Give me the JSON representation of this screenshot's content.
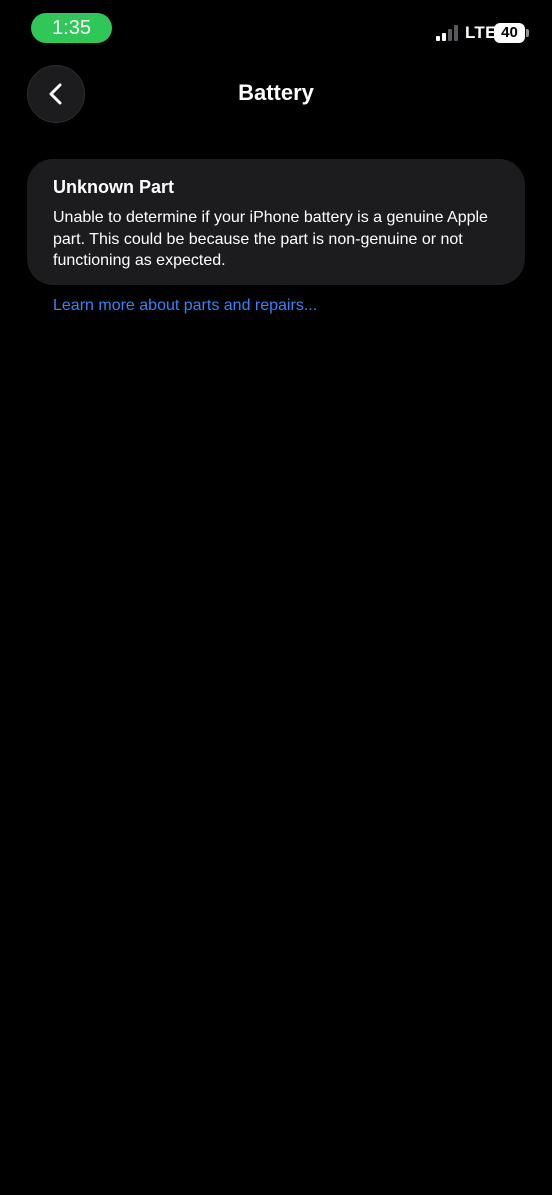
{
  "status_bar": {
    "time": "1:35",
    "network": "LTE",
    "battery_level": "40",
    "signal_bars_active": 2,
    "signal_bars_total": 4,
    "time_pill_color": "#30c759"
  },
  "nav": {
    "title": "Battery",
    "back_icon": "chevron-left-icon"
  },
  "card": {
    "title": "Unknown Part",
    "body": "Unable to determine if your iPhone battery is a genuine Apple part. This could be because the part is non-genuine or not functioning as expected."
  },
  "link": {
    "label": "Learn more about parts and repairs...",
    "color": "#3b82f6"
  }
}
